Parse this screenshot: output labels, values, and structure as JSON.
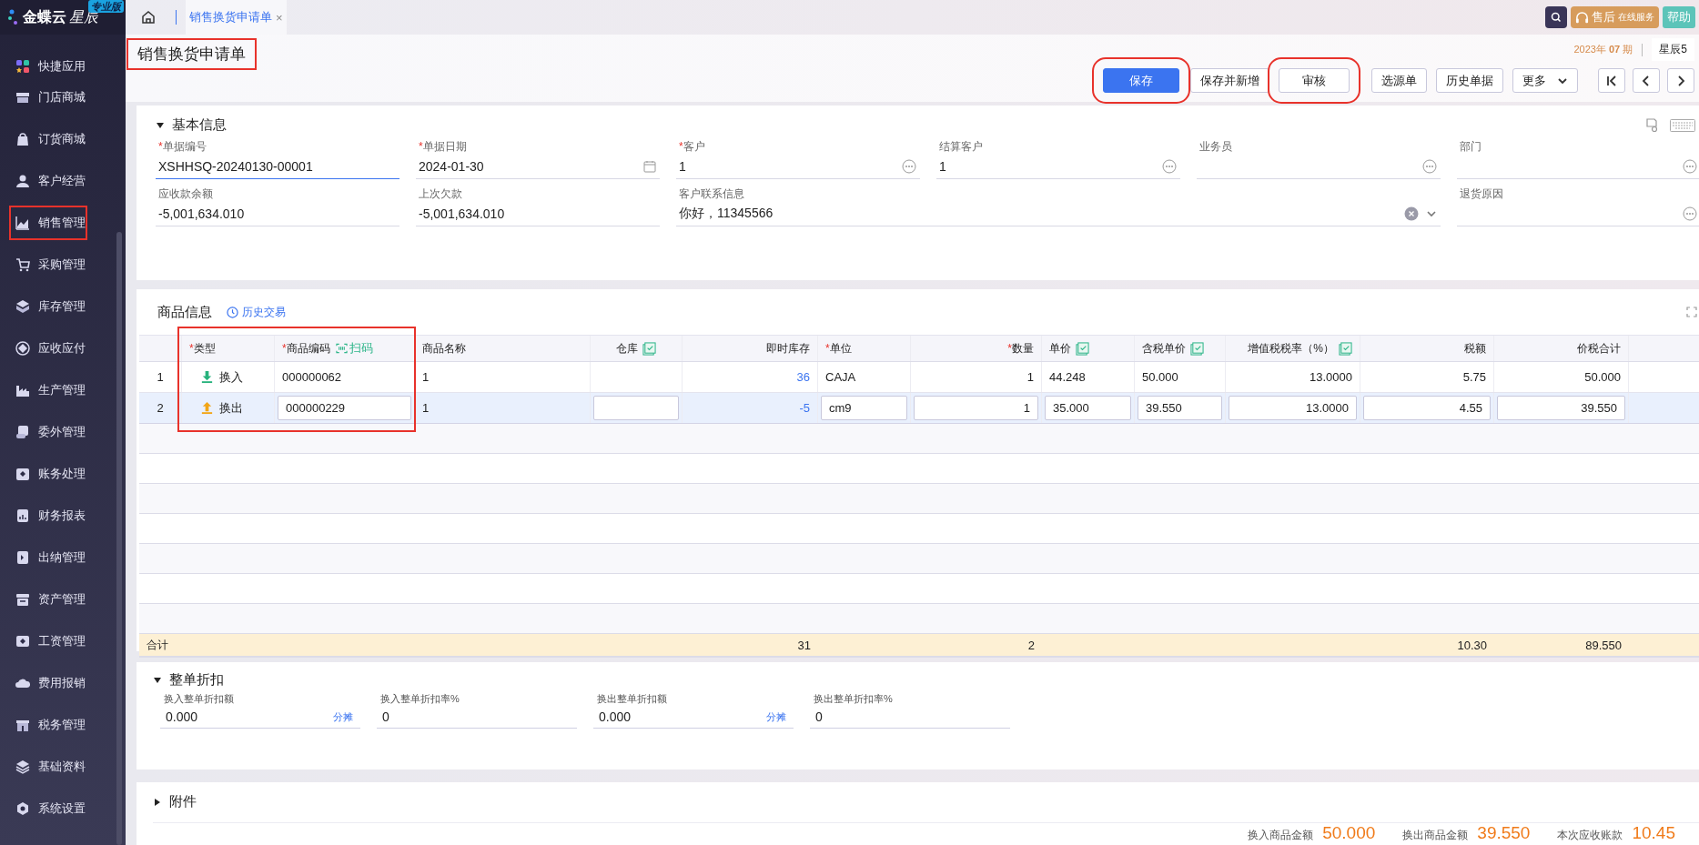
{
  "required_mark": "*",
  "sidebar": {
    "logo": "金蝶云",
    "logo_script": "星辰",
    "edition": "专业版",
    "items": [
      {
        "label": "快捷应用",
        "annotated": false
      },
      {
        "label": "门店商城",
        "annotated": false
      },
      {
        "label": "订货商城",
        "annotated": false
      },
      {
        "label": "客户经营",
        "annotated": false
      },
      {
        "label": "销售管理",
        "annotated": true
      },
      {
        "label": "采购管理",
        "annotated": false
      },
      {
        "label": "库存管理",
        "annotated": false
      },
      {
        "label": "应收应付",
        "annotated": false
      },
      {
        "label": "生产管理",
        "annotated": false
      },
      {
        "label": "委外管理",
        "annotated": false
      },
      {
        "label": "账务处理",
        "annotated": false
      },
      {
        "label": "财务报表",
        "annotated": false
      },
      {
        "label": "出纳管理",
        "annotated": false
      },
      {
        "label": "资产管理",
        "annotated": false
      },
      {
        "label": "工资管理",
        "annotated": false
      },
      {
        "label": "费用报销",
        "annotated": false
      },
      {
        "label": "税务管理",
        "annotated": false
      },
      {
        "label": "基础资料",
        "annotated": false
      },
      {
        "label": "系统设置",
        "annotated": false
      }
    ]
  },
  "tabs": [
    {
      "label": "销售换货申请单",
      "selected": true,
      "close": "×"
    }
  ],
  "top_right": {
    "service": "售后",
    "service_sub": "在线服务",
    "help": "帮助"
  },
  "header": {
    "title": "销售换货申请单",
    "title_annotated": true,
    "period": "2023年 **07** 期",
    "account": "星辰5",
    "buttons": [
      {
        "label": "保存",
        "kind": "primary",
        "annotated": true
      },
      {
        "label": "保存并新增",
        "kind": "default",
        "annotated": false
      },
      {
        "label": "审核",
        "kind": "default",
        "annotated": true
      },
      {
        "label": "选源单",
        "kind": "default",
        "annotated": false
      },
      {
        "label": "历史单据",
        "kind": "default",
        "annotated": false
      },
      {
        "label": "更多",
        "kind": "dropdown",
        "annotated": false
      }
    ]
  },
  "basic_info": {
    "title": "基本信息",
    "expanded": true,
    "fields": [
      {
        "label": "单据编号",
        "required": true,
        "value": "XSHHSQ-20240130-00001",
        "kind": "text",
        "focused": true
      },
      {
        "label": "单据日期",
        "required": true,
        "value": "2024-01-30",
        "kind": "date",
        "focused": false
      },
      {
        "label": "客户",
        "required": true,
        "value": "1",
        "kind": "lookup",
        "focused": false
      },
      {
        "label": "结算客户",
        "required": false,
        "value": "1",
        "kind": "lookup",
        "focused": false
      },
      {
        "label": "业务员",
        "required": false,
        "kind": "lookup",
        "focused": false
      },
      {
        "label": "部门",
        "required": false,
        "kind": "lookup",
        "focused": false
      },
      {
        "label": "应收款余额",
        "required": false,
        "value": "-5,001,634.010",
        "kind": "text",
        "focused": false
      },
      {
        "label": "上次欠款",
        "required": false,
        "value": "-5,001,634.010",
        "kind": "text",
        "focused": false
      },
      {
        "label": "客户联系信息",
        "required": false,
        "value": "你好，11345566",
        "kind": "select",
        "focused": false
      },
      {
        "label": "退货原因",
        "required": false,
        "kind": "lookup",
        "focused": false
      }
    ]
  },
  "products": {
    "title": "商品信息",
    "history_link": "历史交易",
    "annotated": true,
    "columns": [
      {
        "label": "类型",
        "required": true,
        "batch": false
      },
      {
        "label": "商品编码",
        "required": true,
        "tool": "扫码",
        "batch": false,
        "editable": true
      },
      {
        "label": "商品名称",
        "required": false,
        "batch": false,
        "editable": false
      },
      {
        "label": "仓库",
        "required": false,
        "batch": true,
        "editable": true
      },
      {
        "label": "即时库存",
        "required": false,
        "batch": false,
        "editable": false,
        "link": true,
        "total": "31"
      },
      {
        "label": "单位",
        "required": true,
        "batch": false,
        "editable": true
      },
      {
        "label": "数量",
        "required": true,
        "batch": false,
        "editable": true,
        "total": "2"
      },
      {
        "label": "单价",
        "required": false,
        "batch": true,
        "editable": true
      },
      {
        "label": "含税单价",
        "required": false,
        "batch": true,
        "editable": true
      },
      {
        "label": "增值税税率（%）",
        "required": false,
        "batch": true,
        "editable": true
      },
      {
        "label": "税额",
        "required": false,
        "batch": false,
        "editable": true,
        "total": "10.30"
      },
      {
        "label": "价税合计",
        "required": false,
        "batch": false,
        "editable": true,
        "total": "89.550"
      }
    ],
    "rows": [
      {
        "no": "1",
        "kind": "in",
        "selected": false,
        "type": "换入",
        "code": "000000062",
        "name": "1",
        "stock": "36",
        "unit": "CAJA",
        "qty": "1",
        "price": "44.248",
        "tax_price": "50.000",
        "tax_rate": "13.0000",
        "tax": "5.75",
        "amount": "50.000"
      },
      {
        "no": "2",
        "kind": "out",
        "selected": true,
        "type": "换出",
        "code": "000000229",
        "name": "1",
        "stock": "-5",
        "unit": "cm9",
        "qty": "1",
        "price": "35.000",
        "tax_price": "39.550",
        "tax_rate": "13.0000",
        "tax": "4.55",
        "amount": "39.550"
      }
    ],
    "totals_label": "合计"
  },
  "discount": {
    "title": "整单折扣",
    "expanded": true,
    "fields": [
      {
        "label": "换入整单折扣额",
        "value": "0.000",
        "link": "分摊"
      },
      {
        "label": "换入整单折扣率%",
        "value": "0"
      },
      {
        "label": "换出整单折扣额",
        "value": "0.000",
        "link": "分摊"
      },
      {
        "label": "换出整单折扣率%",
        "value": "0"
      }
    ]
  },
  "attachments": {
    "title": "附件",
    "expanded": false
  },
  "summary": [
    {
      "label": "换入商品金额",
      "value": "50.000"
    },
    {
      "label": "换出商品金额",
      "value": "39.550"
    },
    {
      "label": "本次应收账款",
      "value": "10.45"
    }
  ]
}
